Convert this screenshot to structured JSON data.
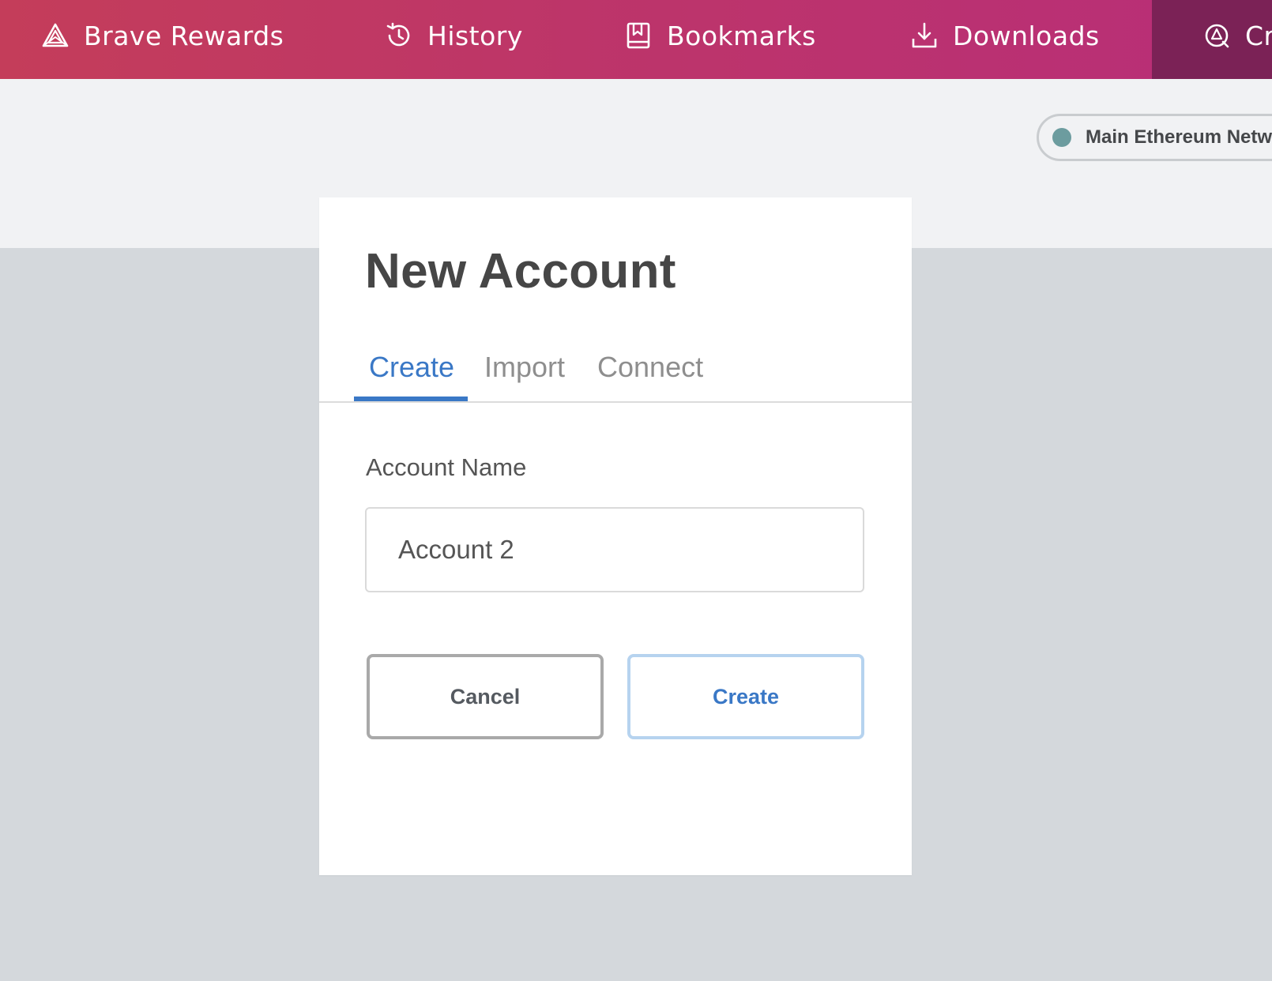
{
  "nav": {
    "items": [
      {
        "label": "Brave Rewards",
        "icon": "brave-rewards-triangle-icon"
      },
      {
        "label": "History",
        "icon": "history-clock-icon"
      },
      {
        "label": "Bookmarks",
        "icon": "bookmark-book-icon"
      },
      {
        "label": "Downloads",
        "icon": "download-icon"
      },
      {
        "label": "Cr",
        "icon": "crypto-wallet-icon"
      }
    ],
    "colors": {
      "gradient_start": "#c43d5a",
      "gradient_end": "#b82e78",
      "active_tab": "#7b2256"
    }
  },
  "network": {
    "label": "Main Ethereum Netwo",
    "status_color": "#6c9c9f"
  },
  "modal": {
    "title": "New Account",
    "tabs": [
      {
        "label": "Create",
        "active": true
      },
      {
        "label": "Import",
        "active": false
      },
      {
        "label": "Connect",
        "active": false
      }
    ],
    "field_label": "Account Name",
    "field_value": "Account 2",
    "cancel_label": "Cancel",
    "create_label": "Create",
    "accent_color": "#3a78c6"
  }
}
